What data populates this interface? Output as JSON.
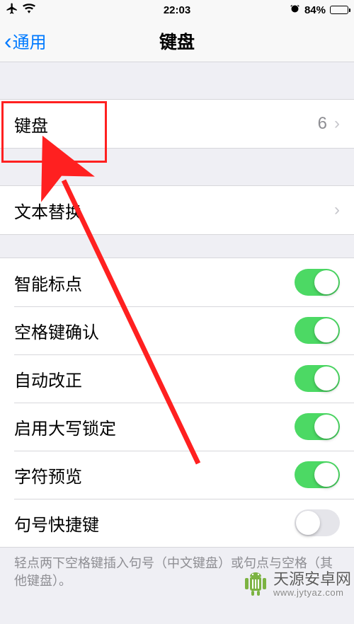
{
  "status": {
    "time": "22:03",
    "battery_pct": "84%"
  },
  "nav": {
    "back_label": "通用",
    "title": "键盘"
  },
  "rows": {
    "keyboards": {
      "label": "键盘",
      "value": "6"
    },
    "text_replace": {
      "label": "文本替换"
    },
    "smart_punct": {
      "label": "智能标点",
      "on": true
    },
    "space_confirm": {
      "label": "空格键确认",
      "on": true
    },
    "auto_correct": {
      "label": "自动改正",
      "on": true
    },
    "caps_lock": {
      "label": "启用大写锁定",
      "on": true
    },
    "char_preview": {
      "label": "字符预览",
      "on": true
    },
    "period_shortcut": {
      "label": "句号快捷键",
      "on": false
    }
  },
  "footer": "轻点两下空格键插入句号（中文键盘）或句点与空格（其他键盘）。",
  "watermark": {
    "name": "天源安卓网",
    "url": "www.jytyaz.com"
  }
}
